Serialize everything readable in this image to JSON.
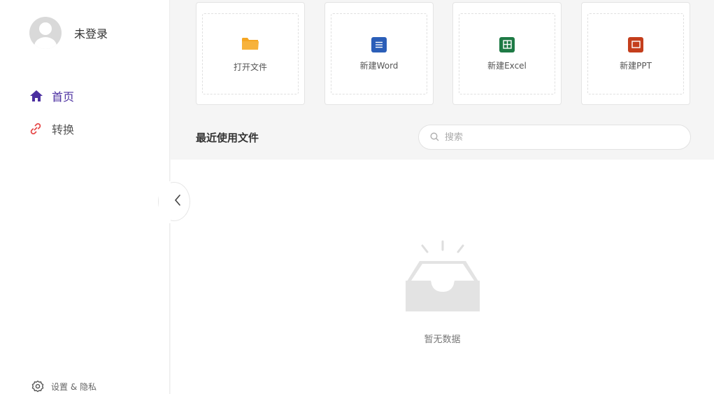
{
  "sidebar": {
    "user_label": "未登录",
    "nav": [
      {
        "label": "首页",
        "icon": "home-icon",
        "active": true,
        "color": "#4b2fa0"
      },
      {
        "label": "转换",
        "icon": "link-icon",
        "active": false,
        "color": "#e64a4a"
      }
    ],
    "settings_label": "设置 & 隐私"
  },
  "quick_actions": [
    {
      "label": "打开文件",
      "icon": "folder-icon",
      "color": "#f5a623"
    },
    {
      "label": "新建Word",
      "icon": "word-icon",
      "color": "#2b5eb8"
    },
    {
      "label": "新建Excel",
      "icon": "excel-icon",
      "color": "#1e7a45"
    },
    {
      "label": "新建PPT",
      "icon": "ppt-icon",
      "color": "#c43e1c"
    }
  ],
  "recent": {
    "title": "最近使用文件",
    "search_placeholder": "搜索",
    "empty_text": "暂无数据"
  }
}
